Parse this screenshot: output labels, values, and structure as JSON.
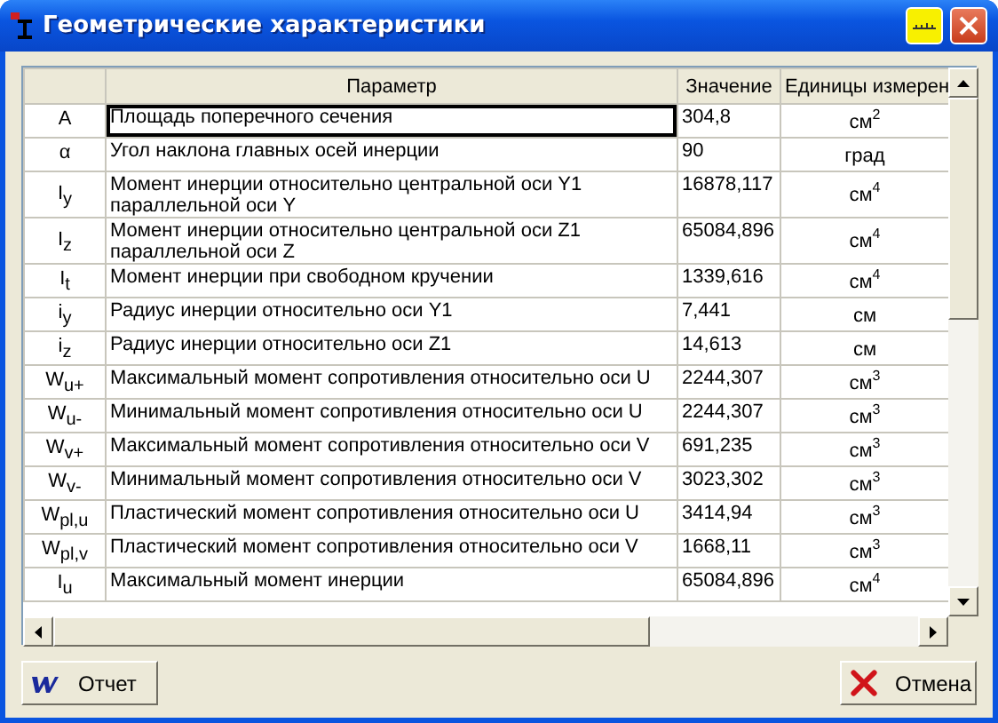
{
  "window": {
    "title": "Геометрические характеристики"
  },
  "table": {
    "columns": [
      "Параметр",
      "Значение",
      "Единицы измерен"
    ],
    "rows": [
      {
        "symbol": "A",
        "name": "Площадь поперечного сечения",
        "value": "304,8",
        "unit": "см$^{2}$",
        "focused": true
      },
      {
        "symbol": "α",
        "name": "Угол наклона главных осей инерции",
        "value": "90",
        "unit": "град",
        "focused": false
      },
      {
        "symbol": "I$_{y}$",
        "name": "Момент инерции относительно центральной оси Y1 параллельной оси Y",
        "value": "16878,117",
        "unit": "см$^{4}$",
        "focused": false
      },
      {
        "symbol": "I$_{z}$",
        "name": "Момент инерции относительно центральной оси Z1 параллельной оси Z",
        "value": "65084,896",
        "unit": "см$^{4}$",
        "focused": false
      },
      {
        "symbol": "I$_{t}$",
        "name": "Момент инерции при свободном кручении",
        "value": "1339,616",
        "unit": "см$^{4}$",
        "focused": false
      },
      {
        "symbol": "i$_{y}$",
        "name": "Радиус инерции относительно оси Y1",
        "value": "7,441",
        "unit": "см",
        "focused": false
      },
      {
        "symbol": "i$_{z}$",
        "name": "Радиус инерции относительно оси Z1",
        "value": "14,613",
        "unit": "см",
        "focused": false
      },
      {
        "symbol": "W$_{u+}$",
        "name": "Максимальный момент сопротивления относительно оси U",
        "value": "2244,307",
        "unit": "см$^{3}$",
        "focused": false
      },
      {
        "symbol": "W$_{u-}$",
        "name": "Минимальный момент сопротивления относительно оси U",
        "value": "2244,307",
        "unit": "см$^{3}$",
        "focused": false
      },
      {
        "symbol": "W$_{v+}$",
        "name": "Максимальный момент сопротивления относительно оси V",
        "value": "691,235",
        "unit": "см$^{3}$",
        "focused": false
      },
      {
        "symbol": "W$_{v-}$",
        "name": "Минимальный момент сопротивления относительно оси V",
        "value": "3023,302",
        "unit": "см$^{3}$",
        "focused": false
      },
      {
        "symbol": "W$_{pl,u}$",
        "name": "Пластический момент сопротивления относительно оси U",
        "value": "3414,94",
        "unit": "см$^{3}$",
        "focused": false
      },
      {
        "symbol": "W$_{pl,v}$",
        "name": "Пластический момент сопротивления относительно оси V",
        "value": "1668,11",
        "unit": "см$^{3}$",
        "focused": false
      },
      {
        "symbol": "I$_{u}$",
        "name": "Максимальный момент инерции",
        "value": "65084,896",
        "unit": "см$^{4}$",
        "focused": false
      }
    ]
  },
  "buttons": [
    {
      "kind": "report",
      "label": "Отчет"
    },
    {
      "kind": "cancel",
      "label": "Отмена"
    }
  ]
}
